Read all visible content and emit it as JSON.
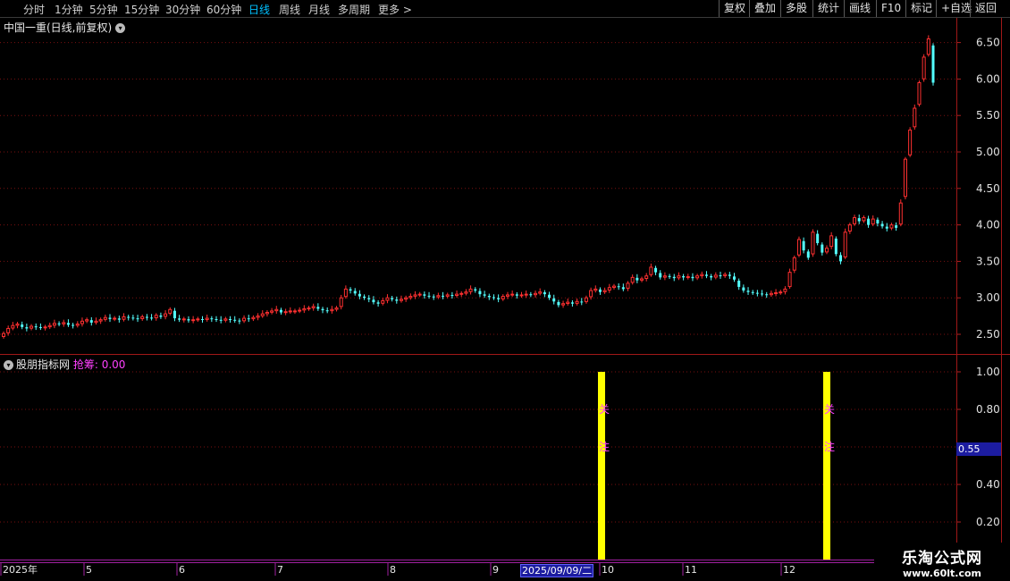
{
  "toolbar": {
    "left_items": [
      "分时",
      "1分钟",
      "5分钟",
      "15分钟",
      "30分钟",
      "60分钟",
      "日线",
      "周线",
      "月线",
      "多周期",
      "更多"
    ],
    "active": "日线",
    "right_items": [
      "复权",
      "叠加",
      "多股",
      "统计",
      "画线",
      "F10",
      "标记",
      "+自选",
      "返回"
    ]
  },
  "chart": {
    "title": "中国一重(日线,前复权)",
    "price_axis": [
      "6.50",
      "6.00",
      "5.50",
      "5.00",
      "4.50",
      "4.00",
      "3.50",
      "3.00",
      "2.50"
    ],
    "up_color": "#ff3030",
    "down_color": "#54ffff"
  },
  "indicator": {
    "name": "股朋指标网",
    "label": "抢筹: 0.00",
    "axis": [
      "1.00",
      "0.80",
      "0.40",
      "0.20"
    ],
    "cursor_value": "0.55",
    "bar_color": "#ffff00",
    "bar_text": [
      "关",
      "注"
    ]
  },
  "time_axis": {
    "labels": [
      "2025年",
      "5",
      "6",
      "7",
      "8",
      "9",
      "10",
      "11",
      "12"
    ],
    "cursor_date": "2025/09/09/二"
  },
  "watermark": {
    "line1": "乐淘公式网",
    "line2": "www.60lt.com"
  },
  "chart_data": {
    "type": "candlestick",
    "title": "中国一重(日线,前复权)",
    "ylim": [
      2.3,
      6.7
    ],
    "yticks": [
      2.5,
      3.0,
      3.5,
      4.0,
      4.5,
      5.0,
      5.5,
      6.0,
      6.5
    ],
    "x_labels": [
      "2025年",
      "5",
      "6",
      "7",
      "8",
      "9",
      "10",
      "11",
      "12"
    ],
    "close_series": [
      2.51,
      2.58,
      2.62,
      2.64,
      2.6,
      2.58,
      2.61,
      2.6,
      2.59,
      2.6,
      2.62,
      2.65,
      2.64,
      2.66,
      2.63,
      2.62,
      2.64,
      2.68,
      2.7,
      2.66,
      2.68,
      2.7,
      2.73,
      2.71,
      2.72,
      2.7,
      2.74,
      2.73,
      2.72,
      2.71,
      2.74,
      2.73,
      2.72,
      2.76,
      2.74,
      2.78,
      2.84,
      2.72,
      2.7,
      2.71,
      2.69,
      2.7,
      2.71,
      2.7,
      2.72,
      2.71,
      2.7,
      2.69,
      2.71,
      2.7,
      2.69,
      2.68,
      2.72,
      2.71,
      2.73,
      2.75,
      2.78,
      2.8,
      2.82,
      2.84,
      2.8,
      2.81,
      2.82,
      2.82,
      2.83,
      2.85,
      2.86,
      2.88,
      2.85,
      2.83,
      2.82,
      2.84,
      2.86,
      3.0,
      3.12,
      3.1,
      3.06,
      3.02,
      3.0,
      2.98,
      2.94,
      2.92,
      2.96,
      3.0,
      2.98,
      2.96,
      2.98,
      3.0,
      3.02,
      3.04,
      3.05,
      3.03,
      3.02,
      3.01,
      3.03,
      3.02,
      3.04,
      3.03,
      3.05,
      3.06,
      3.08,
      3.12,
      3.1,
      3.05,
      3.03,
      3.01,
      3.0,
      2.98,
      3.02,
      3.04,
      3.05,
      3.03,
      3.04,
      3.05,
      3.04,
      3.06,
      3.08,
      3.05,
      3.0,
      2.95,
      2.9,
      2.92,
      2.94,
      2.92,
      2.95,
      2.94,
      3.0,
      3.1,
      3.12,
      3.08,
      3.1,
      3.14,
      3.16,
      3.15,
      3.12,
      3.2,
      3.28,
      3.24,
      3.26,
      3.3,
      3.42,
      3.35,
      3.28,
      3.3,
      3.29,
      3.27,
      3.3,
      3.28,
      3.29,
      3.27,
      3.3,
      3.32,
      3.3,
      3.28,
      3.31,
      3.3,
      3.32,
      3.3,
      3.25,
      3.15,
      3.1,
      3.08,
      3.07,
      3.06,
      3.05,
      3.04,
      3.06,
      3.07,
      3.08,
      3.12,
      3.35,
      3.55,
      3.8,
      3.65,
      3.55,
      3.9,
      3.75,
      3.62,
      3.68,
      3.85,
      3.6,
      3.5,
      3.9,
      4.0,
      4.1,
      4.05,
      4.1,
      4.0,
      4.08,
      4.02,
      3.98,
      3.95,
      4.0,
      3.96,
      4.3,
      4.9,
      5.3,
      5.6,
      5.95,
      6.3,
      6.55,
      5.95
    ]
  }
}
